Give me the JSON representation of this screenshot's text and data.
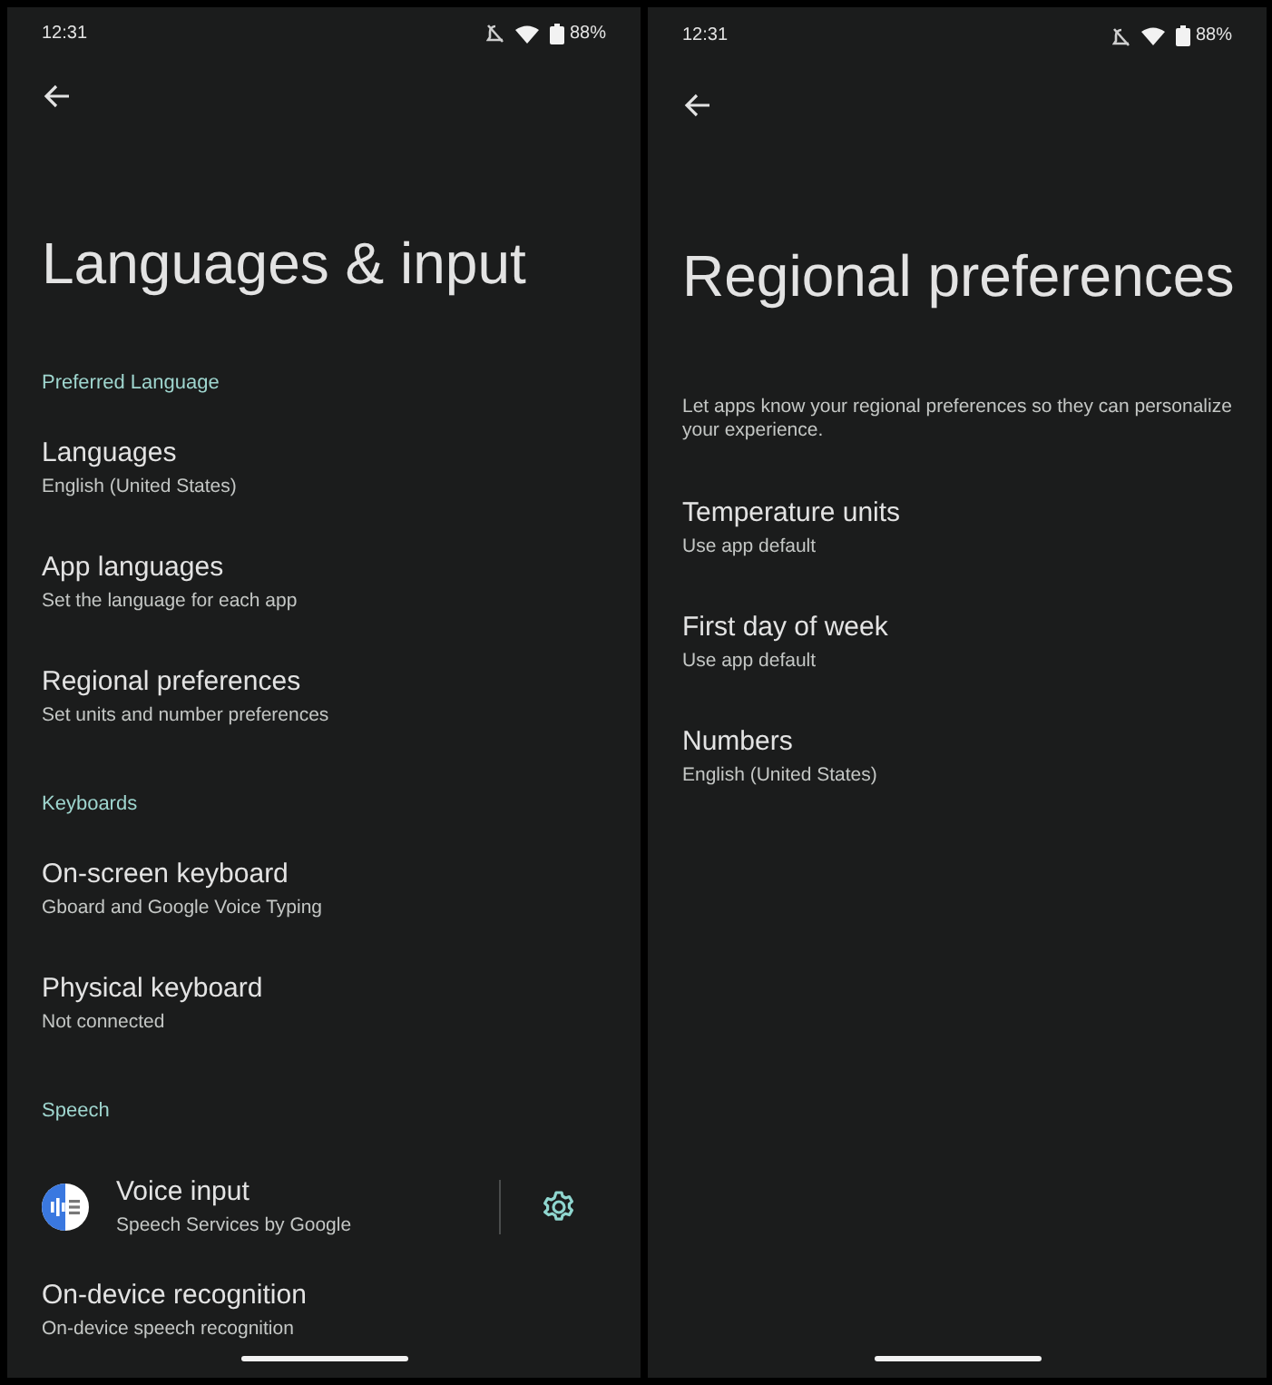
{
  "screens": [
    {
      "status_bar": {
        "time": "12:31",
        "battery": "88%"
      },
      "title": "Languages & input",
      "rows": [
        {
          "kind": "header",
          "title": "Preferred Language"
        },
        {
          "kind": "item",
          "title": "Languages",
          "subtitle": "English (United States)"
        },
        {
          "kind": "item",
          "title": "App languages",
          "subtitle": "Set the language for each app"
        },
        {
          "kind": "item",
          "title": "Regional preferences",
          "subtitle": "Set units and number preferences"
        },
        {
          "kind": "header",
          "title": "Keyboards"
        },
        {
          "kind": "item",
          "title": "On-screen keyboard",
          "subtitle": "Gboard and Google Voice Typing"
        },
        {
          "kind": "item",
          "title": "Physical keyboard",
          "subtitle": "Not connected"
        },
        {
          "kind": "header",
          "title": "Speech"
        },
        {
          "kind": "app_item",
          "title": "Voice input",
          "subtitle": "Speech Services by Google"
        },
        {
          "kind": "item",
          "title": "On-device recognition",
          "subtitle": "On-device speech recognition"
        }
      ]
    },
    {
      "status_bar": {
        "time": "12:31",
        "battery": "88%"
      },
      "title": "Regional preferences",
      "rows": [
        {
          "kind": "description",
          "title": "Let apps know your regional preferences so they can personalize your experience."
        },
        {
          "kind": "item",
          "title": "Temperature units",
          "subtitle": "Use app default"
        },
        {
          "kind": "item",
          "title": "First day of week",
          "subtitle": "Use app default"
        },
        {
          "kind": "item",
          "title": "Numbers",
          "subtitle": "English (United States)"
        }
      ]
    }
  ]
}
